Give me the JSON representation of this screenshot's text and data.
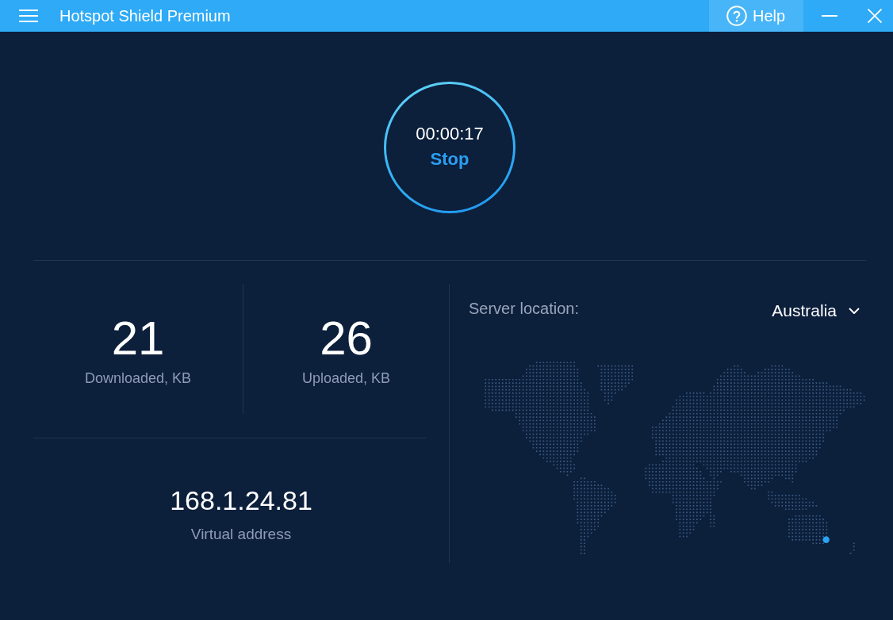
{
  "window": {
    "title": "Hotspot Shield Premium",
    "help_button": "Help"
  },
  "connection": {
    "timer": "00:00:17",
    "action": "Stop"
  },
  "stats": [
    {
      "value": "21",
      "label": "Downloaded, KB"
    },
    {
      "value": "26",
      "label": "Uploaded, KB"
    }
  ],
  "virtual_address": {
    "value": "168.1.24.81",
    "label": "Virtual address"
  },
  "server_location": {
    "label": "Server location:",
    "value": "Australia"
  }
}
